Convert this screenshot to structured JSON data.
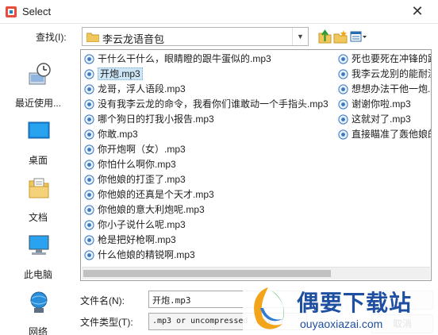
{
  "window": {
    "title": "Select",
    "close_glyph": "✕"
  },
  "toolbar": {
    "look_in_label": "查找(I):",
    "look_in_value": "李云龙语音包",
    "dropdown_glyph": "▼",
    "buttons": [
      "up-one-level",
      "create-new-folder",
      "list-view"
    ]
  },
  "places": [
    {
      "label": "最近使用...",
      "icon": "recent-items-icon"
    },
    {
      "label": "桌面",
      "icon": "desktop-icon"
    },
    {
      "label": "文档",
      "icon": "documents-icon"
    },
    {
      "label": "此电脑",
      "icon": "this-pc-icon"
    },
    {
      "label": "网络",
      "icon": "network-icon"
    }
  ],
  "files": {
    "column1": [
      "干什么干什么，眼睛瞪的跟牛蛋似的.mp3",
      "开炮.mp3",
      "龙哥，浮人语段.mp3",
      "没有我李云龙的命令，我看你们谁敢动一个手指头.mp3",
      "哪个狗日的打我小报告.mp3",
      "你敢.mp3",
      "你开炮啊（女）.mp3",
      "你怕什么啊你.mp3",
      "你他娘的打歪了.mp3",
      "你他娘的还真是个天才.mp3",
      "你他娘的意大利炮呢.mp3",
      "你小子说什么呢.mp3",
      "枪是把好枪啊.mp3",
      "什么他娘的精锐啊.mp3"
    ],
    "column2": [
      "死也要死在冲锋的路",
      "我李云龙别的能耐没",
      "想想办法干他一炮.m",
      "谢谢你啦.mp3",
      "这就对了.mp3",
      "直接瞄准了轰他娘的"
    ],
    "selected_index": 1
  },
  "form": {
    "file_name_label": "文件名(N):",
    "file_name_value": "开炮.mp3",
    "file_type_label": "文件类型(T):",
    "file_type_value": ".mp3 or uncompressed .wav",
    "open_label": "",
    "cancel_label": "取消"
  },
  "watermark": {
    "title": "偶要下载站",
    "url": "ouyaoxiazai.com"
  },
  "colors": {
    "selection_bg": "#cde6f7",
    "folder": "#f1c75b",
    "watermark": "#1f4fa0"
  }
}
